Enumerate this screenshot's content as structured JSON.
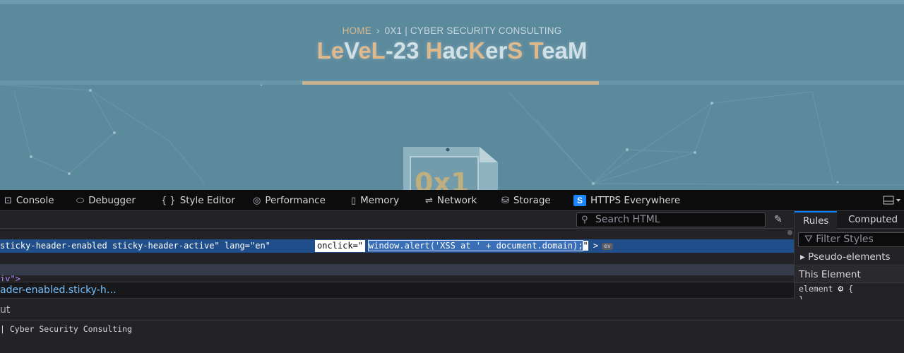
{
  "site": {
    "breadcrumb": {
      "home": "HOME",
      "separator": "›",
      "current": "0X1 | CYBER SECURITY CONSULTING"
    },
    "title_parts": [
      {
        "t": "Le",
        "accent": true
      },
      {
        "t": "V",
        "accent": false
      },
      {
        "t": "eL",
        "accent": true
      },
      {
        "t": "-23 ",
        "accent": false
      },
      {
        "t": "H",
        "accent": true
      },
      {
        "t": "ac",
        "accent": false
      },
      {
        "t": "K",
        "accent": true
      },
      {
        "t": "er",
        "accent": false
      },
      {
        "t": "S",
        "accent": true
      },
      {
        "t": " ",
        "accent": false
      },
      {
        "t": "T",
        "accent": true
      },
      {
        "t": "eaM",
        "accent": false
      }
    ],
    "logo_text": "0x1"
  },
  "devtools": {
    "tabs": [
      {
        "icon": "⊡",
        "icon_name": "console-icon",
        "label": "Console"
      },
      {
        "icon": "⬭",
        "icon_name": "debugger-icon",
        "label": "Debugger"
      },
      {
        "icon": "{ }",
        "icon_name": "style-editor-icon",
        "label": "Style Editor"
      },
      {
        "icon": "◎",
        "icon_name": "performance-icon",
        "label": "Performance"
      },
      {
        "icon": "▯",
        "icon_name": "memory-icon",
        "label": "Memory"
      },
      {
        "icon": "⇌",
        "icon_name": "network-icon",
        "label": "Network"
      },
      {
        "icon": "⛁",
        "icon_name": "storage-icon",
        "label": "Storage"
      },
      {
        "icon": "S",
        "icon_name": "https-everywhere-icon",
        "label": "HTTPS Everywhere"
      }
    ],
    "search_placeholder": "Search HTML",
    "markup": {
      "selected_prefix": "sticky-header-enabled sticky-header-active\" lang=\"en\"",
      "attr_name": "onclick=\"",
      "attr_value": "window.alert('XSS at ' + document.domain);",
      "attr_close": "\"",
      "tag_close": ">",
      "event_badge": "ev",
      "next_line": "iv\">"
    },
    "breadcrumbs": "ader-enabled.sticky-h…",
    "console_tab_fragment": "ut",
    "console_output": "| Cyber Security Consulting",
    "sidebar": {
      "tabs": [
        "Rules",
        "Computed"
      ],
      "filter_placeholder": "Filter Styles",
      "pseudo_elements": "Pseudo-elements",
      "this_element": "This Element",
      "element_rule": "element",
      "brace_open": "{",
      "brace_close": "}"
    }
  },
  "colors": {
    "site_bg": "#5c8a9d",
    "accent_gold": "#e0b98b",
    "devtools_bg": "#232327",
    "selection_blue": "#204e8a",
    "link_blue": "#75bfff"
  }
}
